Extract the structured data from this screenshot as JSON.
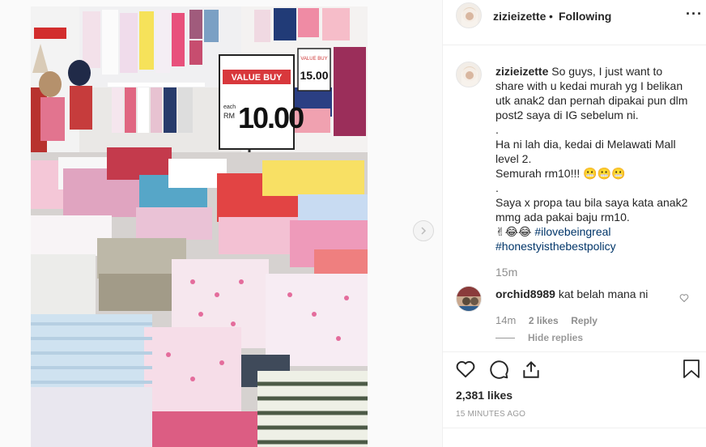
{
  "post": {
    "username": "zizieizette",
    "separator": "•",
    "follow_status": "Following",
    "more_icon": "more-horizontal-icon"
  },
  "photo": {
    "sign_main_title": "VALUE BUY",
    "sign_main_currency": "RM",
    "sign_main_price": "10.00",
    "sign_main_each": "each",
    "sign_small_title": "VALUE BUY",
    "sign_small_price": "15.00"
  },
  "caption": {
    "username": "zizieizette",
    "lines": [
      "So guys, I just want to share with u kedai murah yg I belikan utk anak2 dan pernah dipakai pun dlm post2 saya di IG sebelum ni.",
      ".",
      "Ha ni lah dia, kedai di Melawati Mall level 2.",
      "Semurah rm10!!! 😬😬😬",
      ".",
      "Saya x propa tau bila saya kata anak2 mmg ada pakai baju rm10."
    ],
    "emoji_prefix": "✌😂😂",
    "hashtag_1": "#ilovebeingreal",
    "hashtag_2": "#honestyisthebestpolicy",
    "time": "15m"
  },
  "comment": {
    "username": "orchid8989",
    "text": "kat belah mana ni",
    "time": "14m",
    "likes": "2 likes",
    "reply": "Reply",
    "hide_replies": "Hide replies"
  },
  "footer": {
    "likes": "2,381 likes",
    "time_ago": "15 MINUTES AGO",
    "icons": [
      "heart-icon",
      "comment-icon",
      "share-icon",
      "bookmark-icon"
    ]
  }
}
